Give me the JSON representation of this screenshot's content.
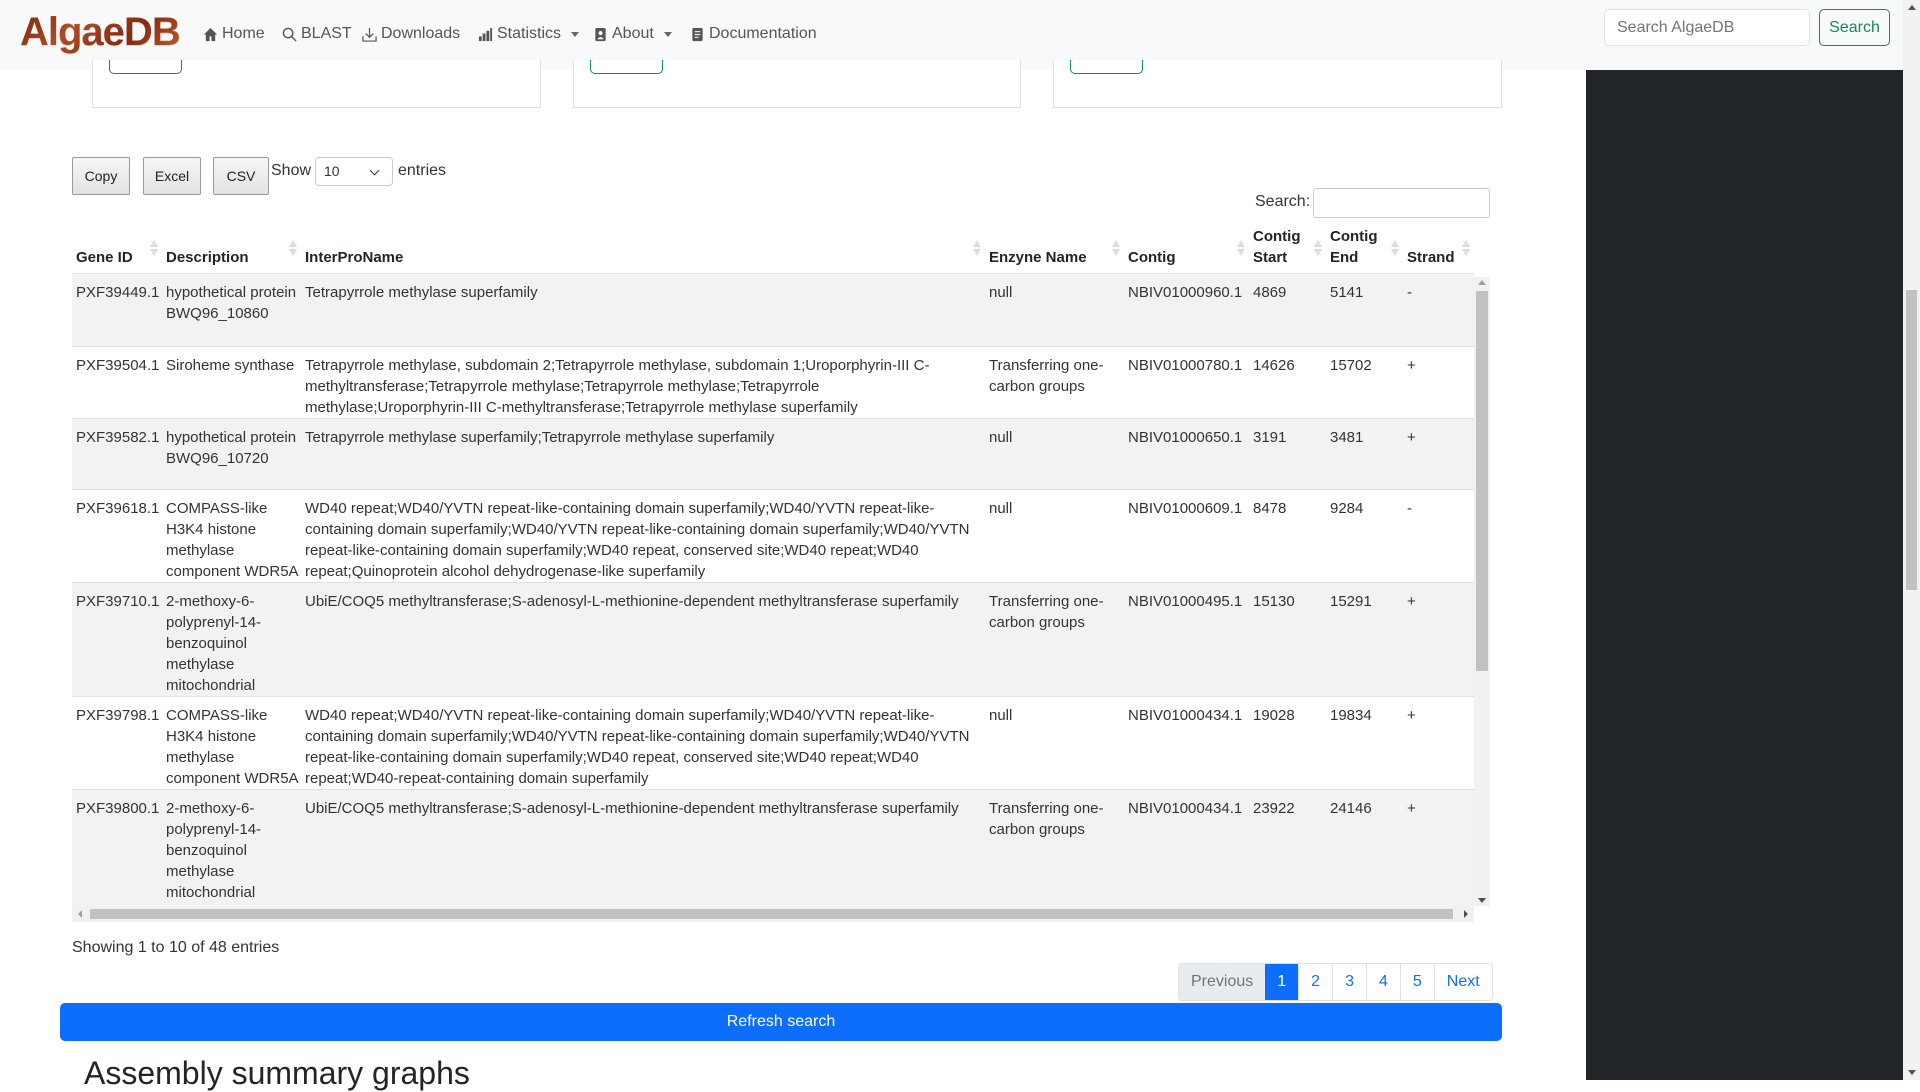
{
  "nav": {
    "logo": "AlgaeDB",
    "items": [
      {
        "label": "Home",
        "icon": "home-icon"
      },
      {
        "label": "BLAST",
        "icon": "search-icon"
      },
      {
        "label": "Downloads",
        "icon": "download-icon"
      },
      {
        "label": "Statistics",
        "icon": "bar-chart-icon",
        "dropdown": true
      },
      {
        "label": "About",
        "icon": "person-badge-icon",
        "dropdown": true
      },
      {
        "label": "Documentation",
        "icon": "document-icon"
      }
    ],
    "search_placeholder": "Search AlgaeDB",
    "search_button": "Search"
  },
  "colors": {
    "brand_green": "#198754",
    "primary": "#0d6efd",
    "sidebar_dark": "#212529"
  },
  "datatable": {
    "buttons": [
      "Copy",
      "Excel",
      "CSV"
    ],
    "show_label": "Show",
    "length_value": "10",
    "entries_label": "entries",
    "search_label": "Search:",
    "search_value": "",
    "columns": [
      "Gene ID",
      "Description",
      "InterProName",
      "Enzyne Name",
      "Contig",
      "Contig Start",
      "Contig End",
      "Strand"
    ],
    "rows": [
      [
        "PXF39449.1",
        "hypothetical protein BWQ96_10860",
        "Tetrapyrrole methylase superfamily",
        "null",
        "NBIV01000960.1",
        "4869",
        "5141",
        "-"
      ],
      [
        "PXF39504.1",
        "Siroheme synthase",
        "Tetrapyrrole methylase, subdomain 2;Tetrapyrrole methylase, subdomain 1;Uroporphyrin-III C-methyltransferase;Tetrapyrrole methylase;Tetrapyrrole methylase;Tetrapyrrole methylase;Uroporphyrin-III C-methyltransferase;Tetrapyrrole methylase superfamily",
        "Transferring one-carbon groups",
        "NBIV01000780.1",
        "14626",
        "15702",
        "+"
      ],
      [
        "PXF39582.1",
        "hypothetical protein BWQ96_10720",
        "Tetrapyrrole methylase superfamily;Tetrapyrrole methylase superfamily",
        "null",
        "NBIV01000650.1",
        "3191",
        "3481",
        "+"
      ],
      [
        "PXF39618.1",
        "COMPASS-like H3K4 histone methylase component WDR5A",
        "WD40 repeat;WD40/YVTN repeat-like-containing domain superfamily;WD40/YVTN repeat-like-containing domain superfamily;WD40/YVTN repeat-like-containing domain superfamily;WD40/YVTN repeat-like-containing domain superfamily;WD40 repeat, conserved site;WD40 repeat;WD40 repeat;Quinoprotein alcohol dehydrogenase-like superfamily",
        "null",
        "NBIV01000609.1",
        "8478",
        "9284",
        "-"
      ],
      [
        "PXF39710.1",
        "2-methoxy-6-polyprenyl-14-benzoquinol methylase mitochondrial",
        "UbiE/COQ5 methyltransferase;S-adenosyl-L-methionine-dependent methyltransferase superfamily",
        "Transferring one-carbon groups",
        "NBIV01000495.1",
        "15130",
        "15291",
        "+"
      ],
      [
        "PXF39798.1",
        "COMPASS-like H3K4 histone methylase component WDR5A",
        "WD40 repeat;WD40/YVTN repeat-like-containing domain superfamily;WD40/YVTN repeat-like-containing domain superfamily;WD40/YVTN repeat-like-containing domain superfamily;WD40/YVTN repeat-like-containing domain superfamily;WD40 repeat, conserved site;WD40 repeat;WD40 repeat;WD40-repeat-containing domain superfamily",
        "null",
        "NBIV01000434.1",
        "19028",
        "19834",
        "+"
      ],
      [
        "PXF39800.1",
        "2-methoxy-6-polyprenyl-14-benzoquinol methylase mitochondrial",
        "UbiE/COQ5 methyltransferase;S-adenosyl-L-methionine-dependent methyltransferase superfamily",
        "Transferring one-carbon groups",
        "NBIV01000434.1",
        "23922",
        "24146",
        "+"
      ]
    ],
    "info": "Showing 1 to 10 of 48 entries",
    "pagination": {
      "previous": "Previous",
      "pages": [
        "1",
        "2",
        "3",
        "4",
        "5"
      ],
      "current": "1",
      "next": "Next"
    }
  },
  "refresh_button": "Refresh search",
  "section_heading": "Assembly summary graphs"
}
